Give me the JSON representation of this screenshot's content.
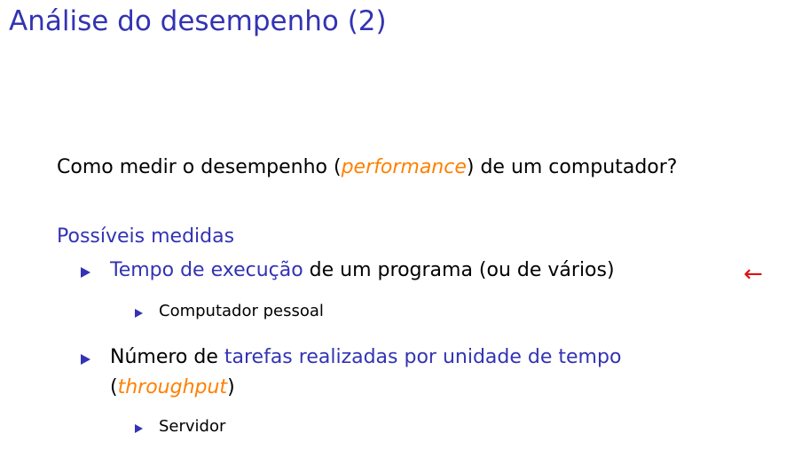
{
  "slide": {
    "title": "Análise do desempenho (2)",
    "question": {
      "before": "Como medir o desempenho (",
      "emphasis": "performance",
      "after": ") de um computador?"
    },
    "section_heading": "Possíveis medidas",
    "items": [
      {
        "highlight": "Tempo de execução",
        "rest": " de um programa (ou de vários)",
        "marker": "←",
        "subitems": [
          "Computador pessoal"
        ]
      },
      {
        "lead": "Número de ",
        "highlight": "tarefas realizadas por unidade de tempo",
        "line2_open": "(",
        "line2_emphasis": "throughput",
        "line2_close": ")",
        "subitems": [
          "Servidor"
        ]
      }
    ],
    "colors": {
      "title_blue": "#3333b3",
      "emphasis_orange": "#ff8000",
      "marker_red": "#e01010"
    }
  }
}
